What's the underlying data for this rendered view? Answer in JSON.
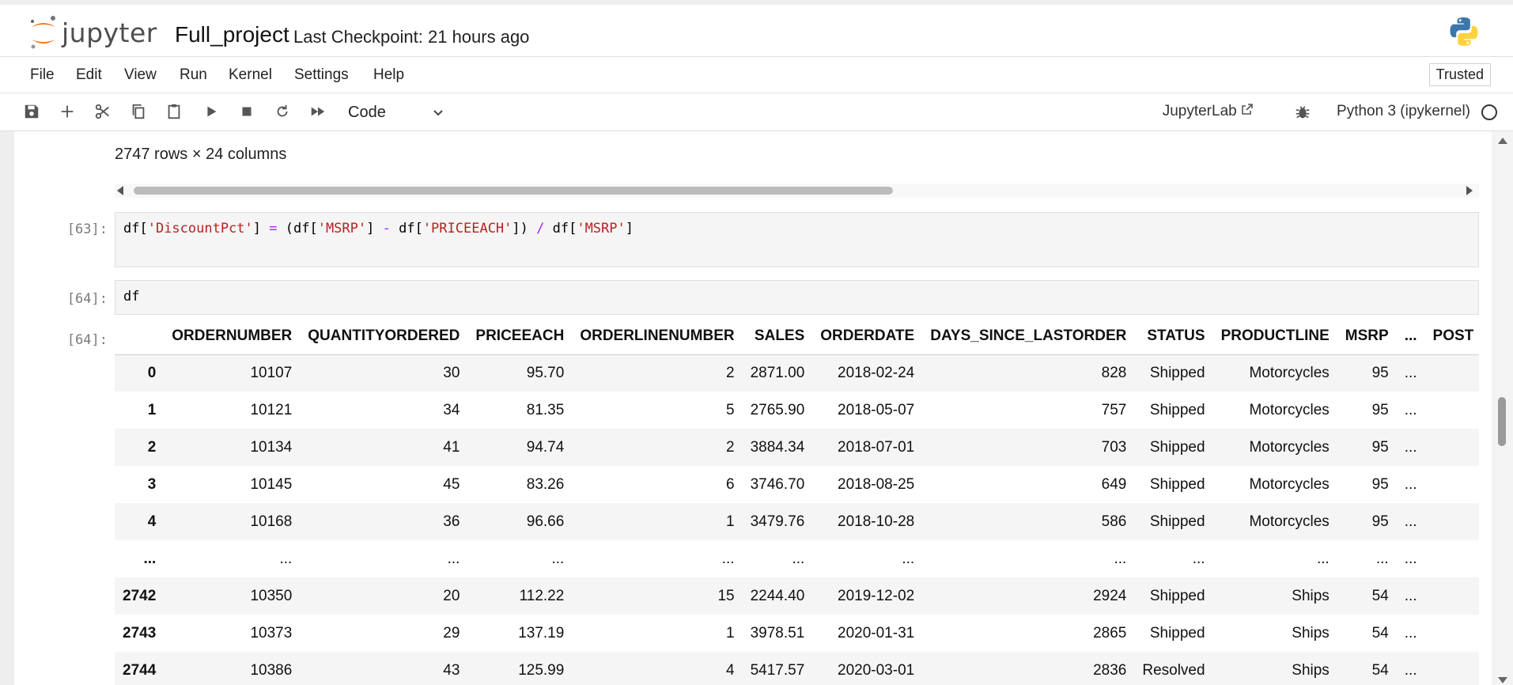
{
  "header": {
    "logo_text": "jupyter",
    "notebook_name": "Full_project",
    "checkpoint": "Last Checkpoint: 21 hours ago"
  },
  "menu": {
    "items": [
      "File",
      "Edit",
      "View",
      "Run",
      "Kernel",
      "Settings",
      "Help"
    ],
    "trusted": "Trusted"
  },
  "toolbar": {
    "icons": [
      "save-icon",
      "add-cell-icon",
      "cut-icon",
      "copy-icon",
      "paste-icon",
      "run-icon",
      "stop-icon",
      "restart-icon",
      "fast-forward-icon"
    ],
    "cell_type": "Code",
    "jupyterlab_label": "JupyterLab",
    "kernel_name": "Python 3 (ipykernel)"
  },
  "output_prev": {
    "rows_info": "2747 rows × 24 columns"
  },
  "cells": [
    {
      "prompt": "[63]:",
      "code_parts": [
        {
          "text": "df[",
          "cls": ""
        },
        {
          "text": "'DiscountPct'",
          "cls": "str"
        },
        {
          "text": "] ",
          "cls": ""
        },
        {
          "text": "=",
          "cls": "op"
        },
        {
          "text": " (df[",
          "cls": ""
        },
        {
          "text": "'MSRP'",
          "cls": "str"
        },
        {
          "text": "] ",
          "cls": ""
        },
        {
          "text": "-",
          "cls": "op"
        },
        {
          "text": " df[",
          "cls": ""
        },
        {
          "text": "'PRICEEACH'",
          "cls": "str"
        },
        {
          "text": "]) ",
          "cls": ""
        },
        {
          "text": "/",
          "cls": "op"
        },
        {
          "text": " df[",
          "cls": ""
        },
        {
          "text": "'MSRP'",
          "cls": "str"
        },
        {
          "text": "]",
          "cls": ""
        }
      ]
    },
    {
      "prompt": "[64]:",
      "code_parts": [
        {
          "text": "df",
          "cls": ""
        }
      ]
    }
  ],
  "output": {
    "prompt": "[64]:",
    "columns": [
      "",
      "ORDERNUMBER",
      "QUANTITYORDERED",
      "PRICEEACH",
      "ORDERLINENUMBER",
      "SALES",
      "ORDERDATE",
      "DAYS_SINCE_LASTORDER",
      "STATUS",
      "PRODUCTLINE",
      "MSRP",
      "...",
      "POST"
    ],
    "rows": [
      [
        "0",
        "10107",
        "30",
        "95.70",
        "2",
        "2871.00",
        "2018-02-24",
        "828",
        "Shipped",
        "Motorcycles",
        "95",
        "...",
        ""
      ],
      [
        "1",
        "10121",
        "34",
        "81.35",
        "5",
        "2765.90",
        "2018-05-07",
        "757",
        "Shipped",
        "Motorcycles",
        "95",
        "...",
        ""
      ],
      [
        "2",
        "10134",
        "41",
        "94.74",
        "2",
        "3884.34",
        "2018-07-01",
        "703",
        "Shipped",
        "Motorcycles",
        "95",
        "...",
        ""
      ],
      [
        "3",
        "10145",
        "45",
        "83.26",
        "6",
        "3746.70",
        "2018-08-25",
        "649",
        "Shipped",
        "Motorcycles",
        "95",
        "...",
        ""
      ],
      [
        "4",
        "10168",
        "36",
        "96.66",
        "1",
        "3479.76",
        "2018-10-28",
        "586",
        "Shipped",
        "Motorcycles",
        "95",
        "...",
        ""
      ],
      [
        "...",
        "...",
        "...",
        "...",
        "...",
        "...",
        "...",
        "...",
        "...",
        "...",
        "...",
        "...",
        ""
      ],
      [
        "2742",
        "10350",
        "20",
        "112.22",
        "15",
        "2244.40",
        "2019-12-02",
        "2924",
        "Shipped",
        "Ships",
        "54",
        "...",
        ""
      ],
      [
        "2743",
        "10373",
        "29",
        "137.19",
        "1",
        "3978.51",
        "2020-01-31",
        "2865",
        "Shipped",
        "Ships",
        "54",
        "...",
        ""
      ],
      [
        "2744",
        "10386",
        "43",
        "125.99",
        "4",
        "5417.57",
        "2020-03-01",
        "2836",
        "Resolved",
        "Ships",
        "54",
        "...",
        ""
      ]
    ]
  }
}
